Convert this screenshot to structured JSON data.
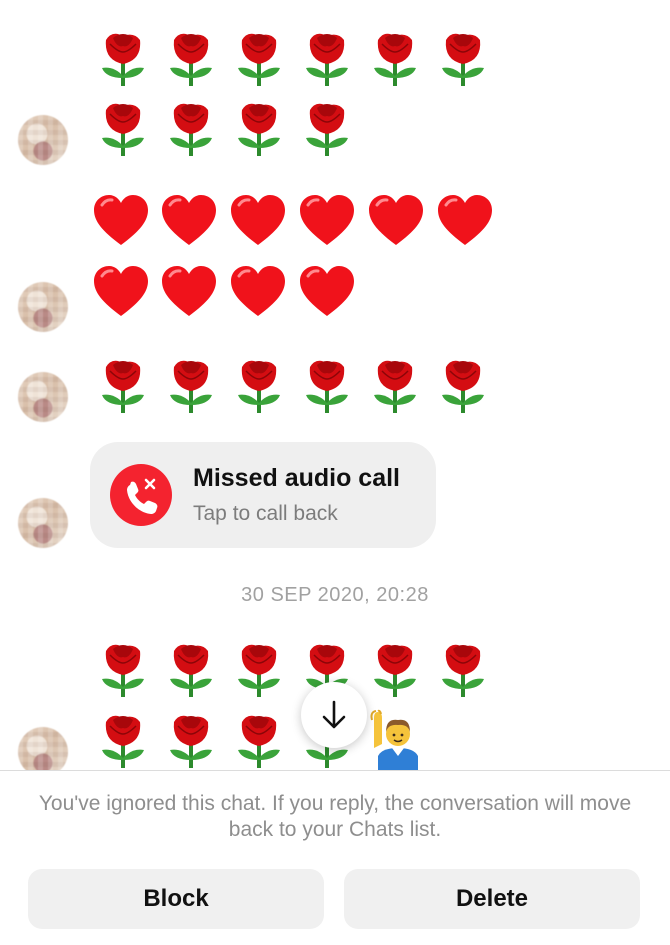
{
  "messages": {
    "rose_row_1_count": 6,
    "rose_row_2_count": 4,
    "heart_row_1_count": 6,
    "heart_row_2_count": 4,
    "rose_row_3_count": 6,
    "rose_row_4_count": 6,
    "rose_row_5_count": 3,
    "emoji_names": [
      "rose",
      "red-heart",
      "raising-hand-man"
    ]
  },
  "missed_call": {
    "title": "Missed audio call",
    "subtitle": "Tap to call back",
    "icon": "missed-call-icon",
    "accent_color": "#f4232f"
  },
  "timestamp": "30 SEP 2020, 20:28",
  "scroll_button": {
    "icon": "arrow-down-icon"
  },
  "footer": {
    "notice": "You've ignored this chat. If you reply, the conversation will move back to your Chats list.",
    "block_label": "Block",
    "delete_label": "Delete"
  }
}
